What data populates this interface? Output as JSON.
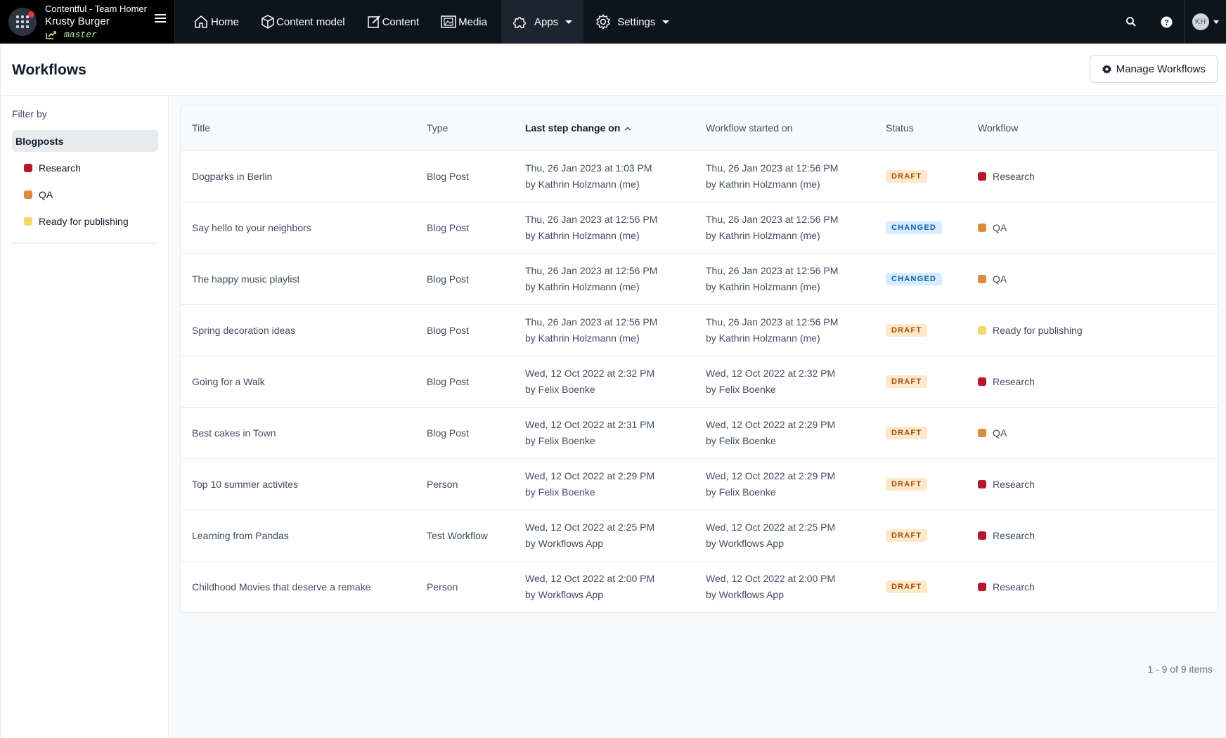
{
  "topbar": {
    "org": "Contentful - Team Homer",
    "space": "Krusty Burger",
    "environment": "master",
    "nav": [
      {
        "label": "Home",
        "icon": "home-icon"
      },
      {
        "label": "Content model",
        "icon": "content-model-icon"
      },
      {
        "label": "Content",
        "icon": "content-icon"
      },
      {
        "label": "Media",
        "icon": "media-icon"
      },
      {
        "label": "Apps",
        "icon": "apps-icon"
      },
      {
        "label": "Settings",
        "icon": "gear-icon"
      }
    ],
    "avatar_initials": "KH"
  },
  "header": {
    "title": "Workflows",
    "manage_label": "Manage Workflows"
  },
  "sidebar": {
    "filter_label": "Filter by",
    "group": "Blogposts",
    "items": [
      {
        "label": "Research",
        "color": "#b5172b"
      },
      {
        "label": "QA",
        "color": "#e08a3c"
      },
      {
        "label": "Ready for publishing",
        "color": "#f5d76e"
      }
    ]
  },
  "table": {
    "columns": [
      "Title",
      "Type",
      "Last step change on",
      "Workflow started on",
      "Status",
      "Workflow"
    ],
    "rows": [
      {
        "title": "Dogparks in Berlin",
        "type": "Blog Post",
        "last_date": "Thu, 26 Jan 2023 at 1:03 PM",
        "last_by": "by Kathrin Holzmann (me)",
        "started_date": "Thu, 26 Jan 2023 at 12:56 PM",
        "started_by": "by Kathrin Holzmann (me)",
        "status": "DRAFT",
        "workflow": "Research",
        "workflow_color": "#b5172b"
      },
      {
        "title": "Say hello to your neighbors",
        "type": "Blog Post",
        "last_date": "Thu, 26 Jan 2023 at 12:56 PM",
        "last_by": "by Kathrin Holzmann (me)",
        "started_date": "Thu, 26 Jan 2023 at 12:56 PM",
        "started_by": "by Kathrin Holzmann (me)",
        "status": "CHANGED",
        "workflow": "QA",
        "workflow_color": "#e08a3c"
      },
      {
        "title": "The happy music playlist",
        "type": "Blog Post",
        "last_date": "Thu, 26 Jan 2023 at 12:56 PM",
        "last_by": "by Kathrin Holzmann (me)",
        "started_date": "Thu, 26 Jan 2023 at 12:56 PM",
        "started_by": "by Kathrin Holzmann (me)",
        "status": "CHANGED",
        "workflow": "QA",
        "workflow_color": "#e08a3c"
      },
      {
        "title": "Spring decoration ideas",
        "type": "Blog Post",
        "last_date": "Thu, 26 Jan 2023 at 12:56 PM",
        "last_by": "by Kathrin Holzmann (me)",
        "started_date": "Thu, 26 Jan 2023 at 12:56 PM",
        "started_by": "by Kathrin Holzmann (me)",
        "status": "DRAFT",
        "workflow": "Ready for publishing",
        "workflow_color": "#f5d76e"
      },
      {
        "title": "Going for a Walk",
        "type": "Blog Post",
        "last_date": "Wed, 12 Oct 2022 at 2:32 PM",
        "last_by": "by Felix Boenke",
        "started_date": "Wed, 12 Oct 2022 at 2:32 PM",
        "started_by": "by Felix Boenke",
        "status": "DRAFT",
        "workflow": "Research",
        "workflow_color": "#b5172b"
      },
      {
        "title": "Best cakes in Town",
        "type": "Blog Post",
        "last_date": "Wed, 12 Oct 2022 at 2:31 PM",
        "last_by": "by Felix Boenke",
        "started_date": "Wed, 12 Oct 2022 at 2:29 PM",
        "started_by": "by Felix Boenke",
        "status": "DRAFT",
        "workflow": "QA",
        "workflow_color": "#e08a3c"
      },
      {
        "title": "Top 10 summer activites",
        "type": "Person",
        "last_date": "Wed, 12 Oct 2022 at 2:29 PM",
        "last_by": "by Felix Boenke",
        "started_date": "Wed, 12 Oct 2022 at 2:29 PM",
        "started_by": "by Felix Boenke",
        "status": "DRAFT",
        "workflow": "Research",
        "workflow_color": "#b5172b"
      },
      {
        "title": "Learning from Pandas",
        "type": "Test Workflow",
        "last_date": "Wed, 12 Oct 2022 at 2:25 PM",
        "last_by": "by Workflows App",
        "started_date": "Wed, 12 Oct 2022 at 2:25 PM",
        "started_by": "by Workflows App",
        "status": "DRAFT",
        "workflow": "Research",
        "workflow_color": "#b5172b"
      },
      {
        "title": "Childhood Movies that deserve a remake",
        "type": "Person",
        "last_date": "Wed, 12 Oct 2022 at 2:00 PM",
        "last_by": "by Workflows App",
        "started_date": "Wed, 12 Oct 2022 at 2:00 PM",
        "started_by": "by Workflows App",
        "status": "DRAFT",
        "workflow": "Research",
        "workflow_color": "#b5172b"
      }
    ],
    "pagination": "1 - 9 of 9 items"
  }
}
